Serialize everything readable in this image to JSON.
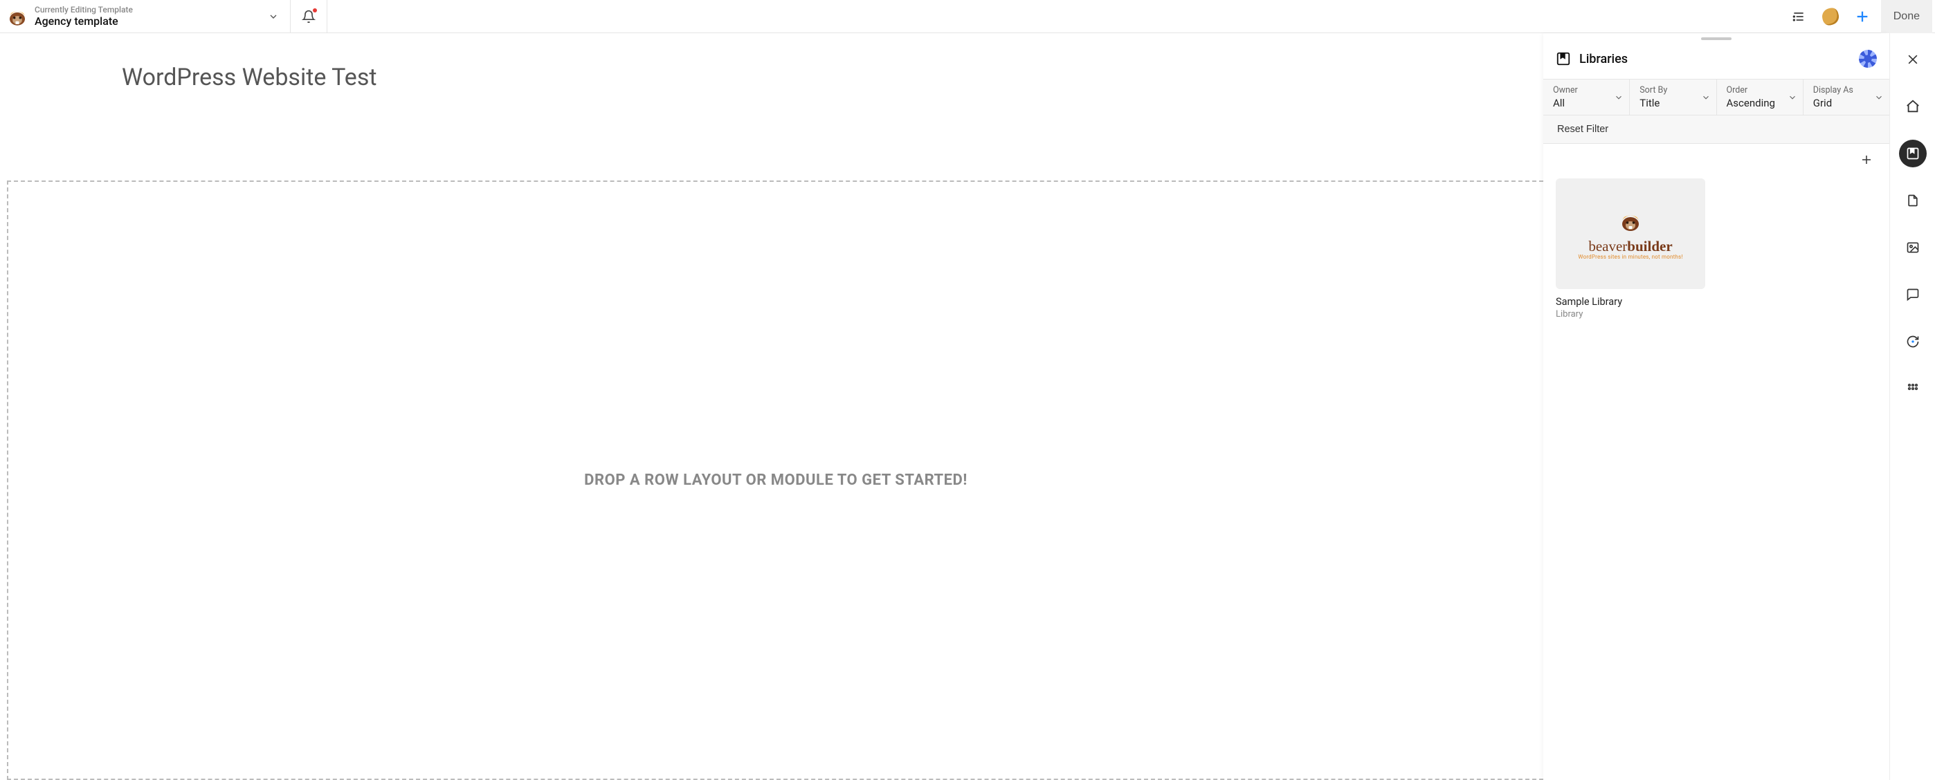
{
  "header": {
    "eyebrow": "Currently Editing Template",
    "title": "Agency template",
    "done_label": "Done"
  },
  "canvas": {
    "site_title": "WordPress Website Test",
    "drop_hint": "DROP A ROW LAYOUT OR MODULE TO GET STARTED!"
  },
  "panel": {
    "title": "Libraries",
    "filters": {
      "owner": {
        "label": "Owner",
        "value": "All"
      },
      "sort_by": {
        "label": "Sort By",
        "value": "Title"
      },
      "order": {
        "label": "Order",
        "value": "Ascending"
      },
      "display": {
        "label": "Display As",
        "value": "Grid"
      }
    },
    "reset_label": "Reset Filter",
    "items": [
      {
        "name": "Sample Library",
        "type": "Library",
        "thumb_brand1": "beaver",
        "thumb_brand2": "builder",
        "thumb_tagline": "WordPress sites in minutes, not months!"
      }
    ]
  },
  "rail": {
    "close": "close",
    "home": "home",
    "library": "library",
    "page": "page",
    "image": "image",
    "comment": "comment",
    "sync": "sync",
    "grid": "grid"
  }
}
